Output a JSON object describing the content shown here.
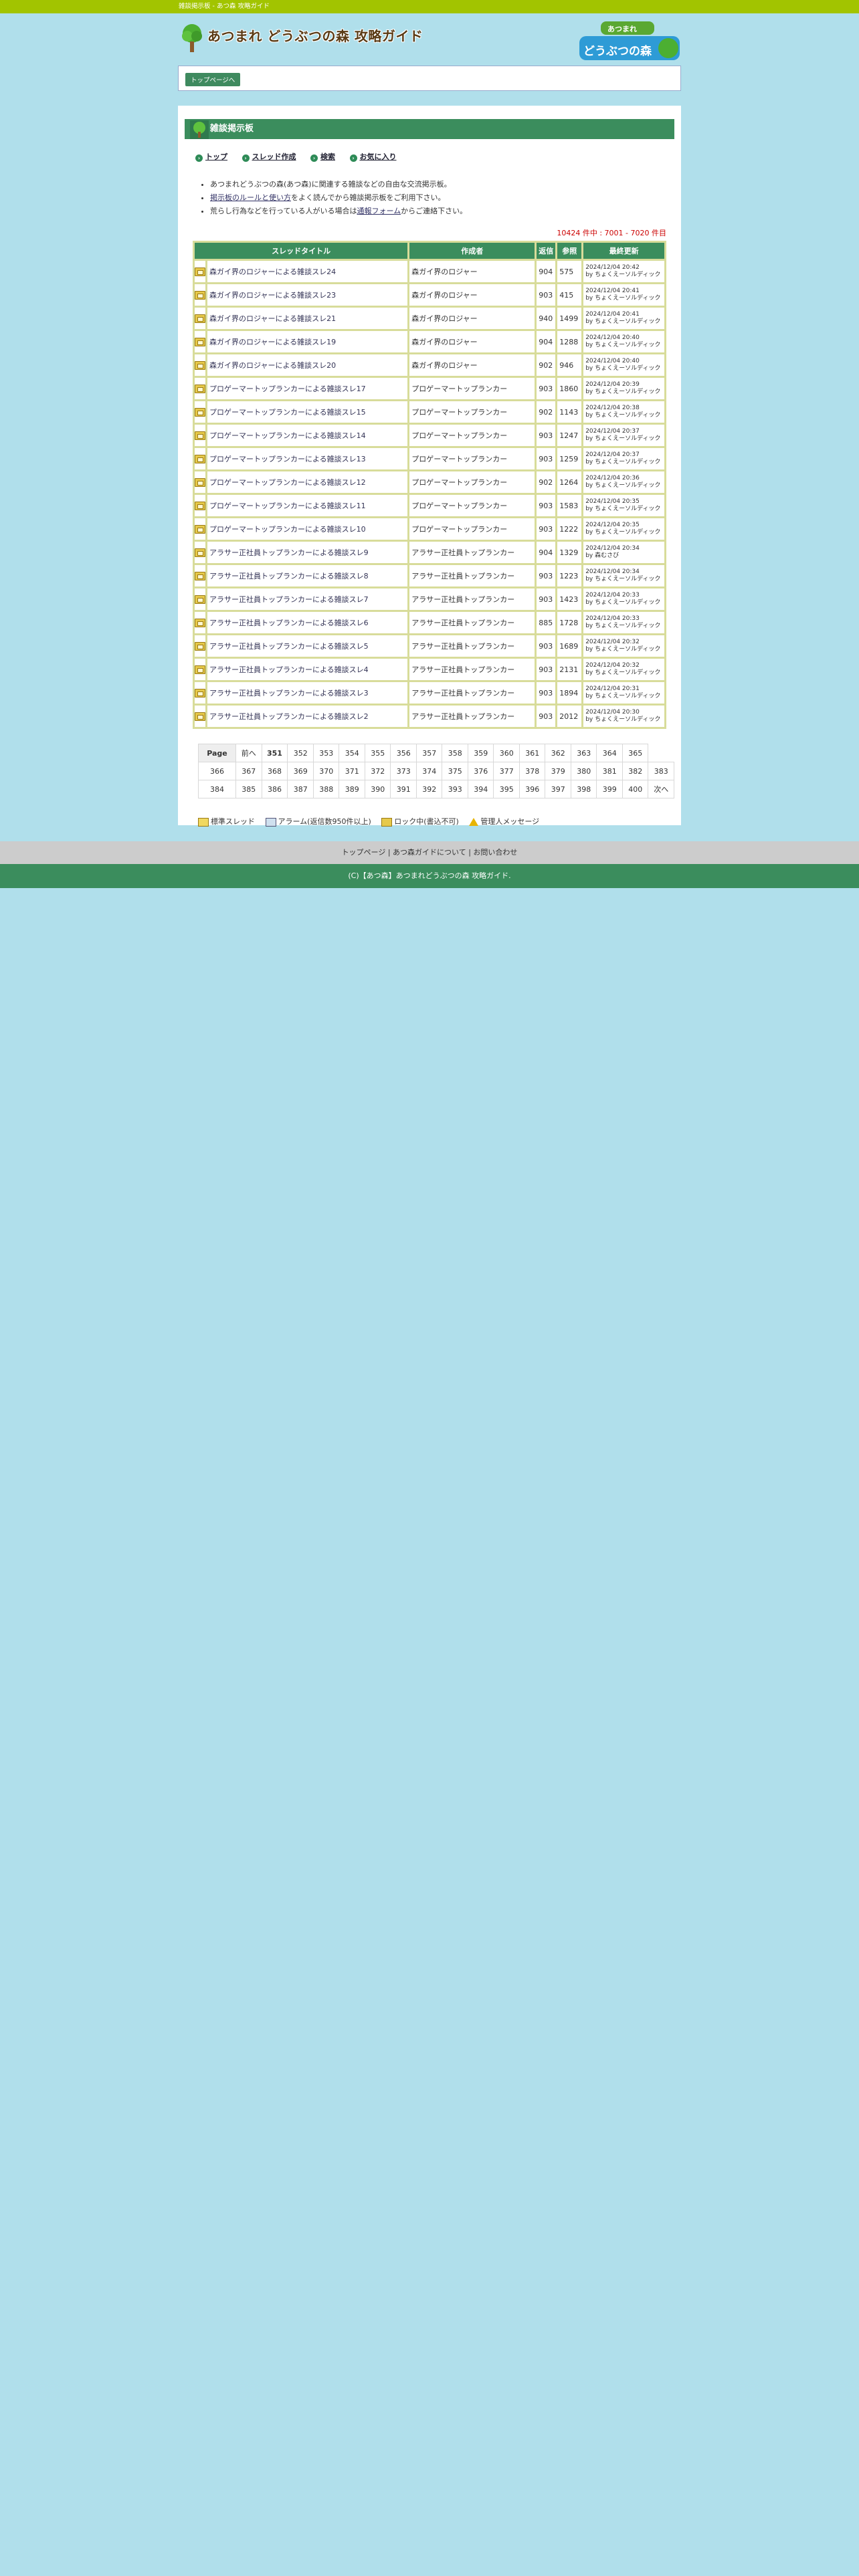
{
  "topbar": {
    "text": "雑談掲示板 - あつ森 攻略ガイド"
  },
  "header": {
    "site_title": "あつまれ どうぶつの森 攻略ガイド",
    "brand_small": "あつまれ",
    "brand_large": "どうぶつの森"
  },
  "breadcrumb": {
    "top_label": "トップページへ"
  },
  "section": {
    "title": "雑談掲示板"
  },
  "nav": {
    "items": [
      "トップ",
      "スレッド作成",
      "検索",
      "お気に入り"
    ]
  },
  "notes": {
    "line1": "あつまれどうぶつの森(あつ森)に関連する雑談などの自由な交流掲示板。",
    "line2_link": "掲示板のルールと使い方",
    "line2_rest": "をよく読んでから雑談掲示板をご利用下さい。",
    "line3_pre": "荒らし行為などを行っている人がいる場合は",
    "line3_link": "通報フォーム",
    "line3_post": "からご連絡下さい。"
  },
  "count_text": "10424 件中 : 7001 - 7020 件目",
  "table": {
    "headers": [
      "スレッドタイトル",
      "作成者",
      "返信",
      "参照",
      "最終更新"
    ],
    "rows": [
      {
        "title": "森ガイ界のロジャーによる雑談スレ24",
        "author": "森ガイ界のロジャー",
        "replies": "904",
        "views": "575",
        "date": "2024/12/04 20:42",
        "by": "by ちょくえーソルディック"
      },
      {
        "title": "森ガイ界のロジャーによる雑談スレ23",
        "author": "森ガイ界のロジャー",
        "replies": "903",
        "views": "415",
        "date": "2024/12/04 20:41",
        "by": "by ちょくえーソルディック"
      },
      {
        "title": "森ガイ界のロジャーによる雑談スレ21",
        "author": "森ガイ界のロジャー",
        "replies": "940",
        "views": "1499",
        "date": "2024/12/04 20:41",
        "by": "by ちょくえーソルディック"
      },
      {
        "title": "森ガイ界のロジャーによる雑談スレ19",
        "author": "森ガイ界のロジャー",
        "replies": "904",
        "views": "1288",
        "date": "2024/12/04 20:40",
        "by": "by ちょくえーソルディック"
      },
      {
        "title": "森ガイ界のロジャーによる雑談スレ20",
        "author": "森ガイ界のロジャー",
        "replies": "902",
        "views": "946",
        "date": "2024/12/04 20:40",
        "by": "by ちょくえーソルディック"
      },
      {
        "title": "プロゲーマートップランカーによる雑談スレ17",
        "author": "プロゲーマートップランカー",
        "replies": "903",
        "views": "1860",
        "date": "2024/12/04 20:39",
        "by": "by ちょくえーソルディック"
      },
      {
        "title": "プロゲーマートップランカーによる雑談スレ15",
        "author": "プロゲーマートップランカー",
        "replies": "902",
        "views": "1143",
        "date": "2024/12/04 20:38",
        "by": "by ちょくえーソルディック"
      },
      {
        "title": "プロゲーマートップランカーによる雑談スレ14",
        "author": "プロゲーマートップランカー",
        "replies": "903",
        "views": "1247",
        "date": "2024/12/04 20:37",
        "by": "by ちょくえーソルディック"
      },
      {
        "title": "プロゲーマートップランカーによる雑談スレ13",
        "author": "プロゲーマートップランカー",
        "replies": "903",
        "views": "1259",
        "date": "2024/12/04 20:37",
        "by": "by ちょくえーソルディック"
      },
      {
        "title": "プロゲーマートップランカーによる雑談スレ12",
        "author": "プロゲーマートップランカー",
        "replies": "902",
        "views": "1264",
        "date": "2024/12/04 20:36",
        "by": "by ちょくえーソルディック"
      },
      {
        "title": "プロゲーマートップランカーによる雑談スレ11",
        "author": "プロゲーマートップランカー",
        "replies": "903",
        "views": "1583",
        "date": "2024/12/04 20:35",
        "by": "by ちょくえーソルディック"
      },
      {
        "title": "プロゲーマートップランカーによる雑談スレ10",
        "author": "プロゲーマートップランカー",
        "replies": "903",
        "views": "1222",
        "date": "2024/12/04 20:35",
        "by": "by ちょくえーソルディック"
      },
      {
        "title": "アラサー正社員トップランカーによる雑談スレ9",
        "author": "アラサー正社員トップランカー",
        "replies": "904",
        "views": "1329",
        "date": "2024/12/04 20:34",
        "by": "by 森むさび"
      },
      {
        "title": "アラサー正社員トップランカーによる雑談スレ8",
        "author": "アラサー正社員トップランカー",
        "replies": "903",
        "views": "1223",
        "date": "2024/12/04 20:34",
        "by": "by ちょくえーソルディック"
      },
      {
        "title": "アラサー正社員トップランカーによる雑談スレ7",
        "author": "アラサー正社員トップランカー",
        "replies": "903",
        "views": "1423",
        "date": "2024/12/04 20:33",
        "by": "by ちょくえーソルディック"
      },
      {
        "title": "アラサー正社員トップランカーによる雑談スレ6",
        "author": "アラサー正社員トップランカー",
        "replies": "885",
        "views": "1728",
        "date": "2024/12/04 20:33",
        "by": "by ちょくえーソルディック"
      },
      {
        "title": "アラサー正社員トップランカーによる雑談スレ5",
        "author": "アラサー正社員トップランカー",
        "replies": "903",
        "views": "1689",
        "date": "2024/12/04 20:32",
        "by": "by ちょくえーソルディック"
      },
      {
        "title": "アラサー正社員トップランカーによる雑談スレ4",
        "author": "アラサー正社員トップランカー",
        "replies": "903",
        "views": "2131",
        "date": "2024/12/04 20:32",
        "by": "by ちょくえーソルディック"
      },
      {
        "title": "アラサー正社員トップランカーによる雑談スレ3",
        "author": "アラサー正社員トップランカー",
        "replies": "903",
        "views": "1894",
        "date": "2024/12/04 20:31",
        "by": "by ちょくえーソルディック"
      },
      {
        "title": "アラサー正社員トップランカーによる雑談スレ2",
        "author": "アラサー正社員トップランカー",
        "replies": "903",
        "views": "2012",
        "date": "2024/12/04 20:30",
        "by": "by ちょくえーソルディック"
      }
    ]
  },
  "pager": {
    "label": "Page",
    "prev": "前へ",
    "next": "次へ",
    "current": "351",
    "row1": [
      "352",
      "353",
      "354",
      "355",
      "356",
      "357",
      "358",
      "359",
      "360",
      "361",
      "362",
      "363",
      "364",
      "365"
    ],
    "row2": [
      "366",
      "367",
      "368",
      "369",
      "370",
      "371",
      "372",
      "373",
      "374",
      "375",
      "376",
      "377",
      "378",
      "379",
      "380",
      "381",
      "382",
      "383"
    ],
    "row3": [
      "384",
      "385",
      "386",
      "387",
      "388",
      "389",
      "390",
      "391",
      "392",
      "393",
      "394",
      "395",
      "396",
      "397",
      "398",
      "399",
      "400"
    ]
  },
  "legend": {
    "items": [
      "標準スレッド",
      "アラーム(返信数950件以上)",
      "ロック中(書込不可)",
      "管理人メッセージ"
    ]
  },
  "footer": {
    "nav": "トップページ | あつ森ガイドについて | お問い合わせ",
    "copyright": "(C)【あつ森】あつまれどうぶつの森 攻略ガイド."
  }
}
